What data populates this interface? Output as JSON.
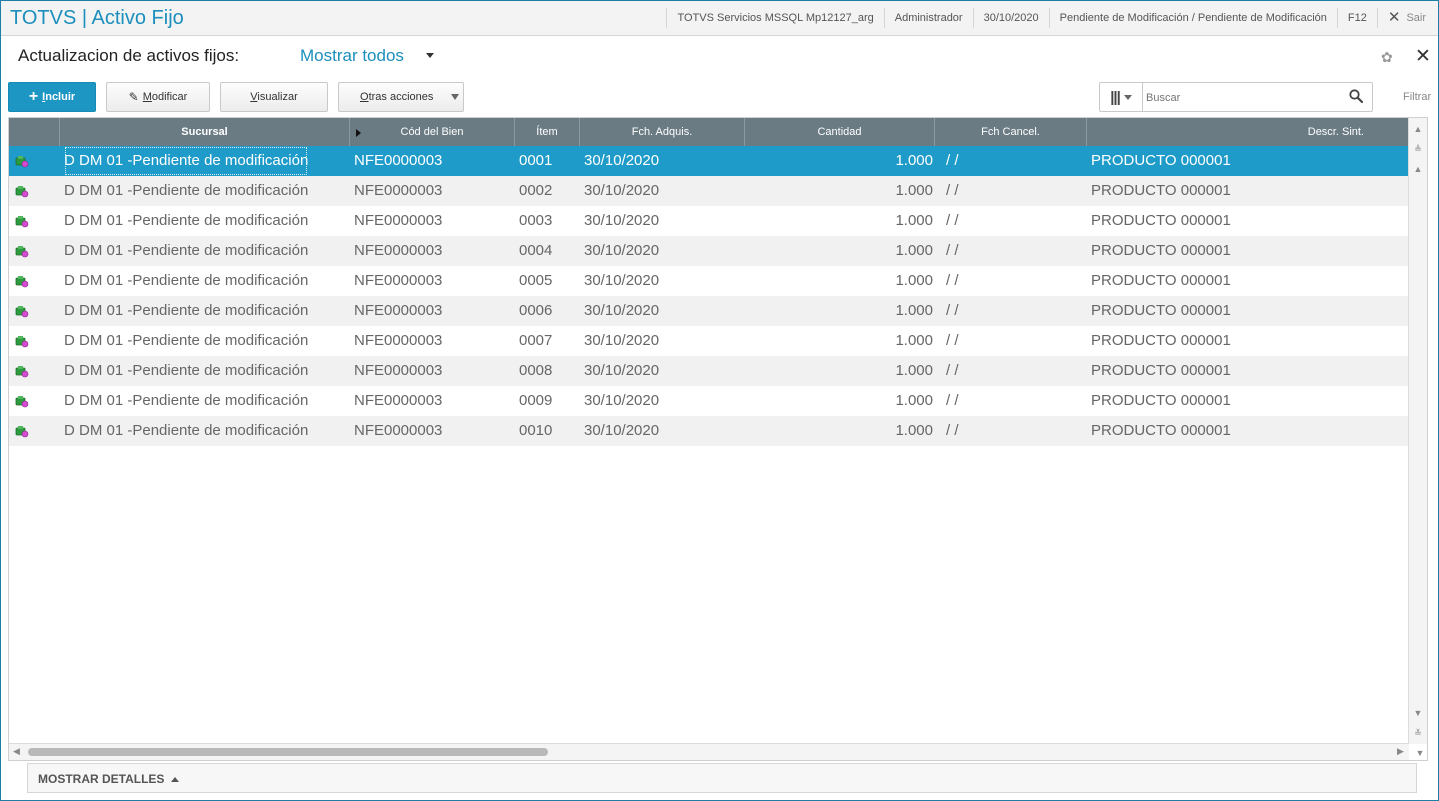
{
  "app": {
    "title": "TOTVS | Activo Fijo",
    "environment": "TOTVS Servicios MSSQL Mp12127_arg",
    "user": "Administrador",
    "date": "30/10/2020",
    "branch": "Pendiente de Modificación / Pendiente de Modificación",
    "shortcut": "F12",
    "exit_label": "Sair"
  },
  "header": {
    "title": "Actualizacion de activos fijos:",
    "view": "Mostrar todos"
  },
  "toolbar": {
    "include_label": "Incluir",
    "modify_label": "Modificar",
    "view_label": "Visualizar",
    "other_label": "Otras acciones",
    "search_placeholder": "Buscar",
    "filter_label": "Filtrar"
  },
  "grid": {
    "columns": [
      "Sucursal",
      "Cód del Bien",
      "Ítem",
      "Fch. Adquis.",
      "Cantidad",
      "Fch Cancel.",
      "Descr. Sint."
    ],
    "rows": [
      {
        "sucursal": "D DM 01 -Pendiente de modificación",
        "codigo": "NFE0000003",
        "item": "0001",
        "fecha": "30/10/2020",
        "cantidad": "1.000",
        "cancel": " /  /",
        "descr": "PRODUCTO 000001"
      },
      {
        "sucursal": "D DM 01 -Pendiente de modificación",
        "codigo": "NFE0000003",
        "item": "0002",
        "fecha": "30/10/2020",
        "cantidad": "1.000",
        "cancel": " /  /",
        "descr": "PRODUCTO 000001"
      },
      {
        "sucursal": "D DM 01 -Pendiente de modificación",
        "codigo": "NFE0000003",
        "item": "0003",
        "fecha": "30/10/2020",
        "cantidad": "1.000",
        "cancel": " /  /",
        "descr": "PRODUCTO 000001"
      },
      {
        "sucursal": "D DM 01 -Pendiente de modificación",
        "codigo": "NFE0000003",
        "item": "0004",
        "fecha": "30/10/2020",
        "cantidad": "1.000",
        "cancel": " /  /",
        "descr": "PRODUCTO 000001"
      },
      {
        "sucursal": "D DM 01 -Pendiente de modificación",
        "codigo": "NFE0000003",
        "item": "0005",
        "fecha": "30/10/2020",
        "cantidad": "1.000",
        "cancel": " /  /",
        "descr": "PRODUCTO 000001"
      },
      {
        "sucursal": "D DM 01 -Pendiente de modificación",
        "codigo": "NFE0000003",
        "item": "0006",
        "fecha": "30/10/2020",
        "cantidad": "1.000",
        "cancel": " /  /",
        "descr": "PRODUCTO 000001"
      },
      {
        "sucursal": "D DM 01 -Pendiente de modificación",
        "codigo": "NFE0000003",
        "item": "0007",
        "fecha": "30/10/2020",
        "cantidad": "1.000",
        "cancel": " /  /",
        "descr": "PRODUCTO 000001"
      },
      {
        "sucursal": "D DM 01 -Pendiente de modificación",
        "codigo": "NFE0000003",
        "item": "0008",
        "fecha": "30/10/2020",
        "cantidad": "1.000",
        "cancel": " /  /",
        "descr": "PRODUCTO 000001"
      },
      {
        "sucursal": "D DM 01 -Pendiente de modificación",
        "codigo": "NFE0000003",
        "item": "0009",
        "fecha": "30/10/2020",
        "cantidad": "1.000",
        "cancel": " /  /",
        "descr": "PRODUCTO 000001"
      },
      {
        "sucursal": "D DM 01 -Pendiente de modificación",
        "codigo": "NFE0000003",
        "item": "0010",
        "fecha": "30/10/2020",
        "cantidad": "1.000",
        "cancel": " /  /",
        "descr": "PRODUCTO 000001"
      }
    ],
    "selected_index": 0,
    "row_icon": "asset-status-icon"
  },
  "footer": {
    "details_label": "MOSTRAR DETALLES"
  },
  "colors": {
    "accent": "#1e96c3",
    "selected_row": "#1e9bc9",
    "header_bg": "#6a7b84"
  }
}
